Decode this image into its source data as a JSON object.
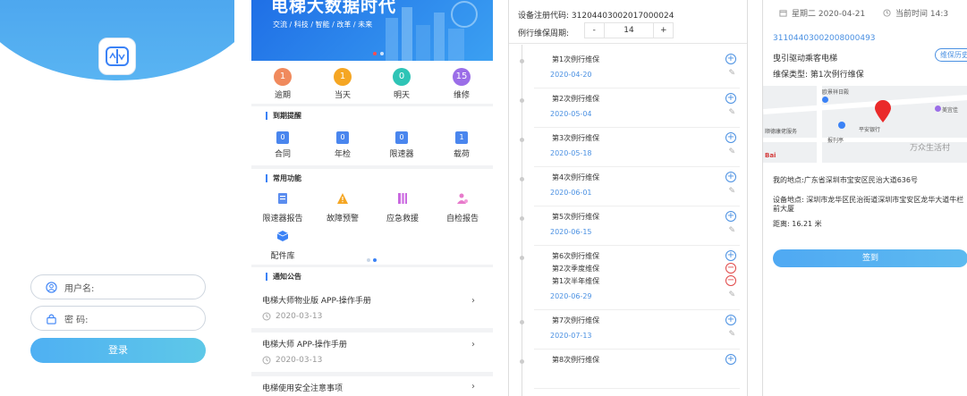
{
  "login": {
    "username_placeholder": "用户名:",
    "password_placeholder": "密  码:",
    "login_label": "登录"
  },
  "home": {
    "banner_title": "电梯大数据时代",
    "banner_subtitle": "交流 / 科技 / 智能 / 改革 / 未来",
    "stats": [
      {
        "value": "1",
        "label": "逾期",
        "color": "#f08a5d"
      },
      {
        "value": "1",
        "label": "当天",
        "color": "#f5a623"
      },
      {
        "value": "0",
        "label": "明天",
        "color": "#2ec4b6"
      },
      {
        "value": "15",
        "label": "维修",
        "color": "#9b6ee8"
      }
    ],
    "expiry_title": "到期提醒",
    "expiry": [
      {
        "value": "0",
        "label": "合同"
      },
      {
        "value": "0",
        "label": "年检"
      },
      {
        "value": "0",
        "label": "限速器"
      },
      {
        "value": "1",
        "label": "载荷"
      }
    ],
    "functions_title": "常用功能",
    "functions": [
      {
        "label": "限速器报告",
        "icon": "report-icon"
      },
      {
        "label": "故障预警",
        "icon": "warning-icon"
      },
      {
        "label": "应急救援",
        "icon": "rescue-icon"
      },
      {
        "label": "自检报告",
        "icon": "self-check-icon"
      },
      {
        "label": "配件库",
        "icon": "parts-icon"
      }
    ],
    "notice_title": "通知公告",
    "notices": [
      {
        "title": "电梯大师物业版 APP-操作手册",
        "date": "2020-03-13"
      },
      {
        "title": "电梯大师 APP-操作手册",
        "date": "2020-03-13"
      },
      {
        "title": "电梯使用安全注意事项",
        "date": ""
      }
    ]
  },
  "maintenance": {
    "reg_code_label": "设备注册代码: 31204403002017000024",
    "period_label": "例行维保周期:",
    "period_minus": "-",
    "period_value": "14",
    "period_plus": "+",
    "items": [
      {
        "lines": [
          "第1次例行维保"
        ],
        "date": "2020-04-20",
        "marks": [
          "plus"
        ]
      },
      {
        "lines": [
          "第2次例行维保"
        ],
        "date": "2020-05-04",
        "marks": [
          "plus"
        ]
      },
      {
        "lines": [
          "第3次例行维保"
        ],
        "date": "2020-05-18",
        "marks": [
          "plus"
        ]
      },
      {
        "lines": [
          "第4次例行维保"
        ],
        "date": "2020-06-01",
        "marks": [
          "plus"
        ]
      },
      {
        "lines": [
          "第5次例行维保"
        ],
        "date": "2020-06-15",
        "marks": [
          "plus"
        ]
      },
      {
        "lines": [
          "第6次例行维保",
          "第2次季度维保",
          "第1次半年维保"
        ],
        "date": "2020-06-29",
        "marks": [
          "plus",
          "minus",
          "minus"
        ]
      },
      {
        "lines": [
          "第7次例行维保"
        ],
        "date": "2020-07-13",
        "marks": [
          "plus"
        ]
      },
      {
        "lines": [
          "第8次例行维保"
        ],
        "date": "",
        "marks": [
          "plus"
        ]
      }
    ]
  },
  "checkin": {
    "date_label": "星期二 2020-04-21",
    "time_label": "当前时间 14:3",
    "reg_code": "31104403002008000493",
    "elevator_name": "曳引驱动乘客电梯",
    "history_label": "维保历史",
    "maint_type": "维保类型: 第1次例行维保",
    "my_location": "我的地点:广东省深圳市宝安区民治大道636号",
    "device_location": "设备地点: 深圳市龙华区民治街道深圳市宝安区龙华大道牛栏前大厦",
    "distance": "距离: 16.21 米",
    "checkin_label": "签到",
    "map_labels": {
      "village": "欧景祥日殿",
      "bank": "平安银行",
      "store": "美宜佳",
      "plaza": "万众生活村",
      "service": "顺德康佬服务",
      "police": "报刊亭",
      "baidu": "Bai"
    }
  }
}
